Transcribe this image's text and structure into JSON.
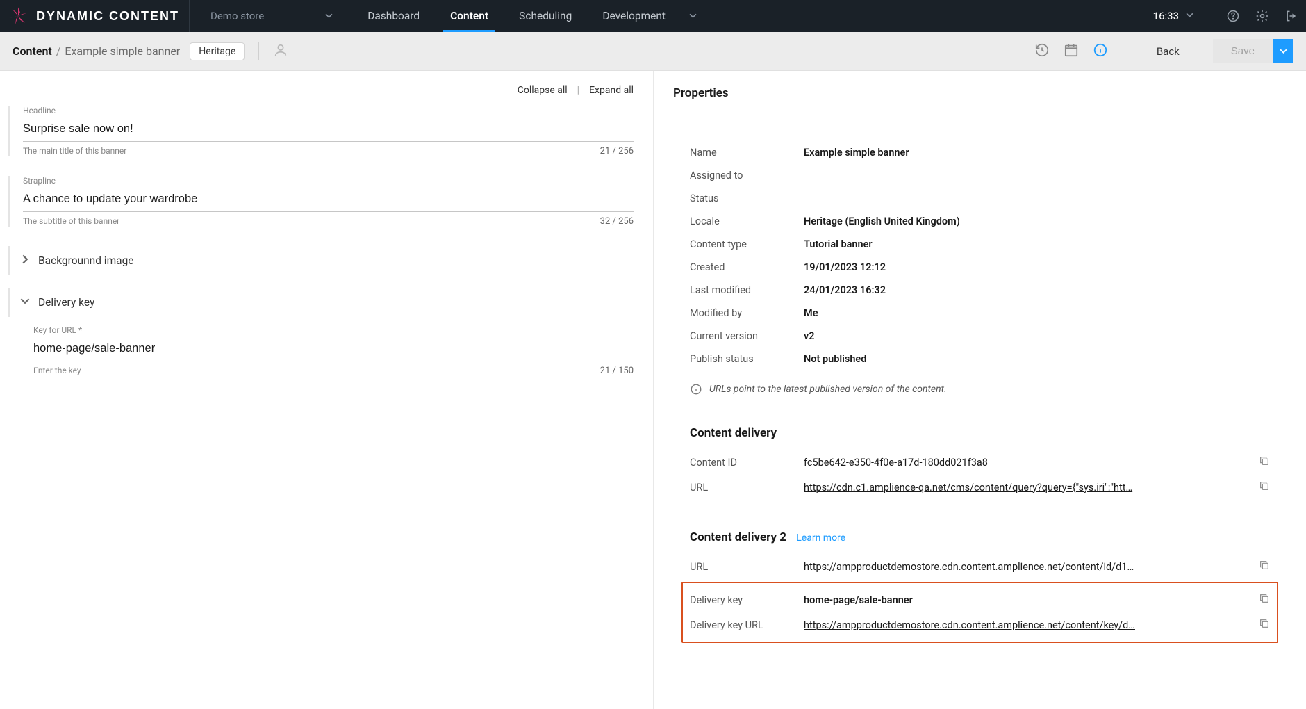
{
  "app": {
    "name": "DYNAMIC CONTENT"
  },
  "store": {
    "name": "Demo store"
  },
  "nav": {
    "dashboard": "Dashboard",
    "content": "Content",
    "scheduling": "Scheduling",
    "development": "Development"
  },
  "time": "16:33",
  "breadcrumb": {
    "root": "Content",
    "leaf": "Example simple banner",
    "tag": "Heritage"
  },
  "subbar_actions": {
    "back": "Back",
    "save": "Save"
  },
  "form_toolbar": {
    "collapse": "Collapse all",
    "expand": "Expand all"
  },
  "fields": {
    "headline": {
      "label": "Headline",
      "value": "Surprise sale now on!",
      "hint": "The main title of this banner",
      "counter": "21 / 256"
    },
    "strapline": {
      "label": "Strapline",
      "value": "A chance to update your wardrobe",
      "hint": "The subtitle of this banner",
      "counter": "32 / 256"
    },
    "bgimage": {
      "title": "Backgrounnd image"
    },
    "delivery_key_section": {
      "title": "Delivery key"
    },
    "delivery_key": {
      "label": "Key for URL *",
      "value": "home-page/sale-banner",
      "hint": "Enter the key",
      "counter": "21 / 150"
    }
  },
  "properties": {
    "heading": "Properties",
    "rows": {
      "name": {
        "label": "Name",
        "value": "Example simple banner"
      },
      "assigned": {
        "label": "Assigned to",
        "value": ""
      },
      "status": {
        "label": "Status",
        "value": ""
      },
      "locale": {
        "label": "Locale",
        "value": "Heritage (English United Kingdom)"
      },
      "ctype": {
        "label": "Content type",
        "value": "Tutorial banner"
      },
      "created": {
        "label": "Created",
        "value": "19/01/2023 12:12"
      },
      "modified": {
        "label": "Last modified",
        "value": "24/01/2023 16:32"
      },
      "modby": {
        "label": "Modified by",
        "value": "Me"
      },
      "version": {
        "label": "Current version",
        "value": "v2"
      },
      "pub": {
        "label": "Publish status",
        "value": "Not published"
      }
    },
    "note": "URLs point to the latest published version of the content."
  },
  "delivery1": {
    "heading": "Content delivery",
    "content_id": {
      "label": "Content ID",
      "value": "fc5be642-e350-4f0e-a17d-180dd021f3a8"
    },
    "url": {
      "label": "URL",
      "value": "https://cdn.c1.amplience-qa.net/cms/content/query?query={\"sys.iri\":\"htt…"
    }
  },
  "delivery2": {
    "heading": "Content delivery 2",
    "learn_more": "Learn more",
    "url": {
      "label": "URL",
      "value": "https://ampproductdemostore.cdn.content.amplience.net/content/id/d1…"
    },
    "dkey": {
      "label": "Delivery key",
      "value": "home-page/sale-banner"
    },
    "dkeyurl": {
      "label": "Delivery key URL",
      "value": "https://ampproductdemostore.cdn.content.amplience.net/content/key/d…"
    }
  }
}
